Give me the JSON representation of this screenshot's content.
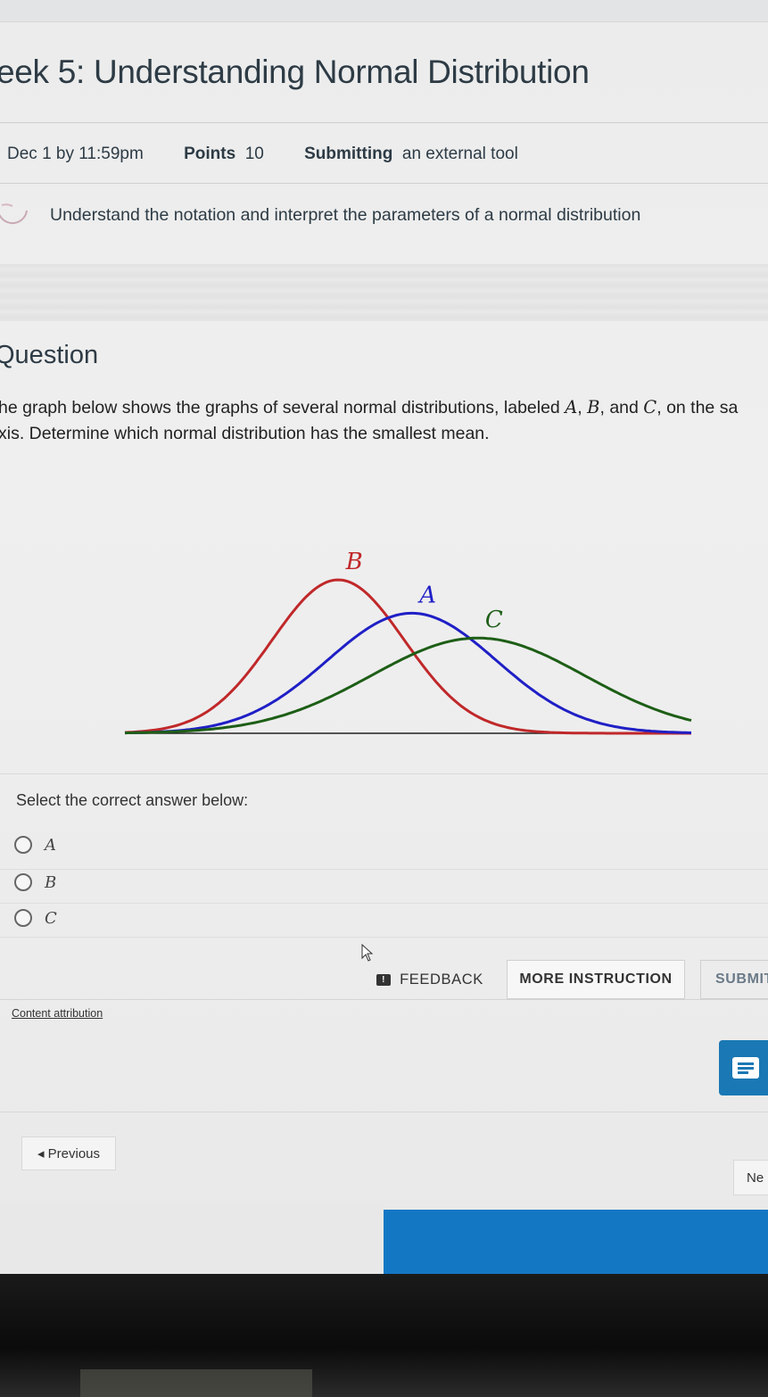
{
  "header": {
    "title": "eek 5: Understanding Normal Distribution"
  },
  "meta": {
    "due": "Dec 1 by 11:59pm",
    "points_label": "Points",
    "points_value": "10",
    "submitting_label": "Submitting",
    "submitting_value": "an external tool"
  },
  "objective": {
    "text": "Understand the notation and interpret the parameters of a normal distribution"
  },
  "question": {
    "heading": "Question",
    "line1_pre": "he graph below shows the graphs of several normal distributions, labeled ",
    "var_a": "A",
    "var_b": "B",
    "var_c": "C",
    "and": "and",
    "line1_post": "on the sa",
    "line2": "xis. Determine which normal distribution has the smallest mean."
  },
  "chart_data": {
    "type": "line",
    "series": [
      {
        "name": "B",
        "mean": -1.0,
        "sd": 0.9,
        "color": "#c0282a"
      },
      {
        "name": "A",
        "mean": 0.0,
        "sd": 1.15,
        "color": "#1f1fc6"
      },
      {
        "name": "C",
        "mean": 0.9,
        "sd": 1.45,
        "color": "#1d5e16"
      }
    ],
    "xlim": [
      -3.9,
      3.8
    ]
  },
  "answer": {
    "prompt": "Select the correct answer below:",
    "options": [
      "A",
      "B",
      "C"
    ]
  },
  "buttons": {
    "feedback": "FEEDBACK",
    "more_instruction": "MORE INSTRUCTION",
    "submit": "SUBMIT"
  },
  "footer": {
    "content_attribution": "Content attribution",
    "previous": "◂ Previous",
    "next": "Ne"
  }
}
